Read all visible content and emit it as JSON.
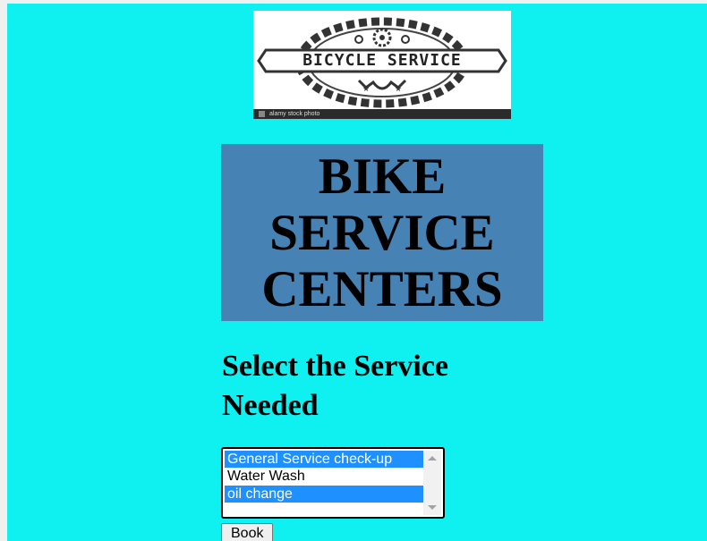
{
  "logo": {
    "text": "BICYCLE SERVICE",
    "watermark": "alamy stock photo"
  },
  "banner": {
    "line1": "BIKE",
    "line2": "SERVICE",
    "line3": "CENTERS"
  },
  "subtitle": {
    "line1": "Select the Service",
    "line2": "Needed"
  },
  "service_select": {
    "options": [
      {
        "label": "General Service check-up",
        "selected": true
      },
      {
        "label": "Water Wash",
        "selected": false
      },
      {
        "label": "oil change",
        "selected": true
      }
    ]
  },
  "book_button": {
    "label": "Book"
  },
  "colors": {
    "page_background": "#0ff0f0",
    "banner_background": "#4682b4",
    "selection": "#1e90ff"
  }
}
